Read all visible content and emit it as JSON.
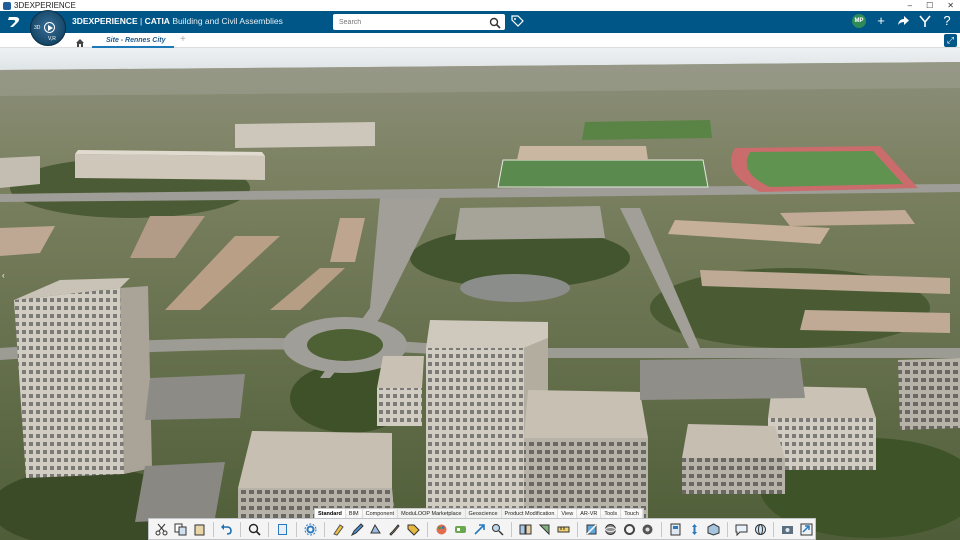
{
  "window": {
    "title": "3DEXPERIENCE",
    "controls": [
      "–",
      "☐",
      "✕"
    ]
  },
  "header": {
    "brand_bold": "3DEXPERIENCE",
    "brand_separator": " | ",
    "brand_app": "CATIA",
    "brand_context": " Building and Civil Assemblies",
    "search_placeholder": "Search",
    "avatar_initials": "MP",
    "compass": {
      "label_3d": "3D",
      "label_v": "V,R"
    },
    "colors": {
      "bar": "#005686",
      "accent": "#1d78b8"
    }
  },
  "tabs": {
    "active_tab": "Site - Rennes City",
    "add_tab": "+"
  },
  "action_bar": {
    "sections": [
      "Standard",
      "BIM",
      "Component",
      "ModuLOOP Marketplace",
      "Geoscience",
      "Product Modification",
      "View",
      "AR-VR",
      "Tools",
      "Touch"
    ],
    "active_section": "Standard",
    "icons": [
      "cut-icon",
      "copy-icon",
      "paste-icon",
      "undo-icon",
      "zoom-icon",
      "book-icon",
      "settings-gear-icon",
      "sketch-icon",
      "pencil-icon",
      "shape-icon",
      "brush-icon",
      "tag-icon",
      "paint-icon",
      "palette-icon",
      "arrow-icon",
      "search-part-icon",
      "compare-icon",
      "snap-icon",
      "measure-icon",
      "section-icon",
      "sphere-icon",
      "ring-icon",
      "rotate-icon",
      "shield-icon",
      "move-icon",
      "cube-icon",
      "chat-icon",
      "globe-icon",
      "capture-icon",
      "export-icon"
    ]
  }
}
